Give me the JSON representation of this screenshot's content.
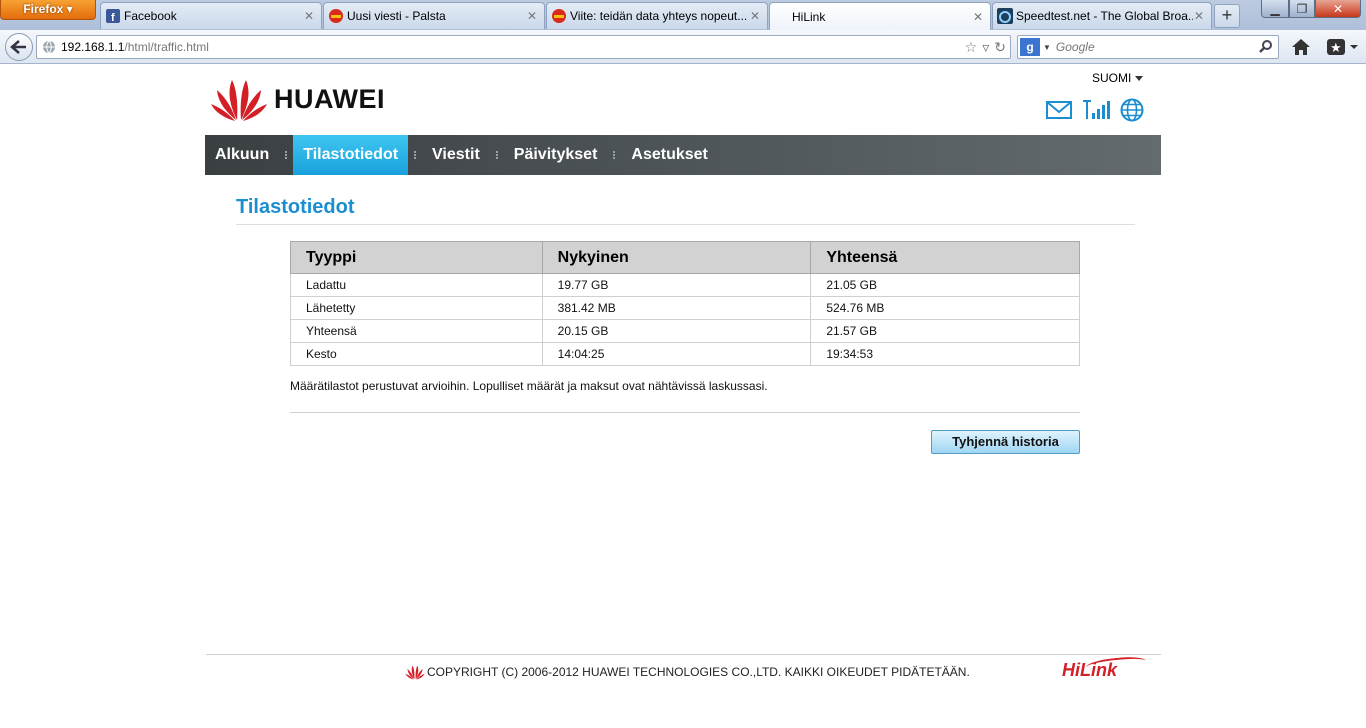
{
  "browser": {
    "menu_button": "Firefox",
    "tabs": [
      {
        "title": "Facebook",
        "icon": "facebook-icon"
      },
      {
        "title": "Uusi viesti - Palsta",
        "icon": "palsta-icon"
      },
      {
        "title": "Viite: teidän data yhteys nopeut...",
        "icon": "palsta-icon"
      },
      {
        "title": "HiLink",
        "icon": "none"
      },
      {
        "title": "Speedtest.net - The Global Broa...",
        "icon": "speedtest-icon"
      }
    ],
    "url_host": "192.168.1.1",
    "url_path": "/html/traffic.html",
    "search_placeholder": "Google"
  },
  "header": {
    "brand": "HUAWEI",
    "language": "SUOMI"
  },
  "nav": {
    "items": [
      "Alkuun",
      "Tilastotiedot",
      "Viestit",
      "Päivitykset",
      "Asetukset"
    ],
    "active": "Tilastotiedot"
  },
  "main": {
    "title": "Tilastotiedot",
    "table": {
      "headers": [
        "Tyyppi",
        "Nykyinen",
        "Yhteensä"
      ],
      "rows": [
        [
          "Ladattu",
          "19.77 GB",
          "21.05 GB"
        ],
        [
          "Lähetetty",
          "381.42 MB",
          "524.76 MB"
        ],
        [
          "Yhteensä",
          "20.15 GB",
          "21.57 GB"
        ],
        [
          "Kesto",
          "14:04:25",
          "19:34:53"
        ]
      ]
    },
    "note": "Määrätilastot perustuvat arvioihin. Lopulliset määrät ja maksut ovat nähtävissä laskussasi.",
    "clear_button": "Tyhjennä historia"
  },
  "footer": {
    "copyright": "COPYRIGHT (C) 2006-2012 HUAWEI TECHNOLOGIES CO.,LTD. KAIKKI OIKEUDET PIDÄTETÄÄN.",
    "product_logo": "HiLink"
  },
  "colors": {
    "accent": "#1a8ed1",
    "nav_active": "#18a1dc",
    "brand_red": "#d31f26"
  }
}
